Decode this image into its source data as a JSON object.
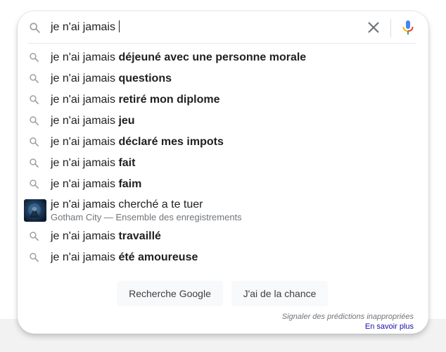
{
  "search": {
    "query": "je n'ai jamais "
  },
  "suggestions": [
    {
      "prefix": "je n'ai jamais ",
      "completion": "déjeuné avec une personne morale"
    },
    {
      "prefix": "je n'ai jamais ",
      "completion": "questions"
    },
    {
      "prefix": "je n'ai jamais ",
      "completion": "retiré mon diplome"
    },
    {
      "prefix": "je n'ai jamais ",
      "completion": "jeu"
    },
    {
      "prefix": "je n'ai jamais ",
      "completion": "déclaré mes impots"
    },
    {
      "prefix": "je n'ai jamais ",
      "completion": "fait"
    },
    {
      "prefix": "je n'ai jamais ",
      "completion": "faim"
    }
  ],
  "rich_suggestion": {
    "title": "je n'ai jamais cherché a te tuer",
    "subtitle": "Gotham City — Ensemble des enregistrements"
  },
  "suggestions_after": [
    {
      "prefix": "je n'ai jamais ",
      "completion": "travaillé"
    },
    {
      "prefix": "je n'ai jamais ",
      "completion": "été amoureuse"
    }
  ],
  "buttons": {
    "search_label": "Recherche Google",
    "lucky_label": "J'ai de la chance"
  },
  "footer": {
    "report_text": "Signaler des prédictions inappropriées",
    "learn_more": "En savoir plus"
  },
  "icons": {
    "search": "search-icon",
    "clear": "close-icon",
    "mic": "microphone-icon"
  },
  "colors": {
    "link": "#1a0dab",
    "muted": "#70757a",
    "icon_grey": "#9aa0a6",
    "mic_blue": "#4285f4",
    "mic_red": "#ea4335",
    "mic_yellow": "#fbbc04",
    "mic_green": "#34a853"
  }
}
